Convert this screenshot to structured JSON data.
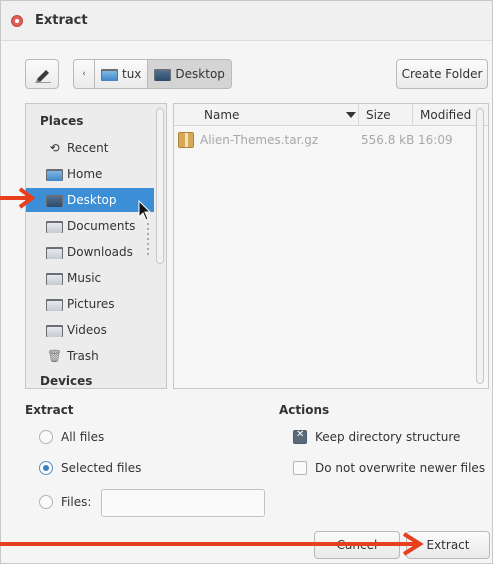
{
  "title": "Extract",
  "toolbar": {
    "create_folder_label": "Create Folder"
  },
  "pathbar": {
    "arrow_label": "‹",
    "crumbs": [
      {
        "label": "tux",
        "icon": "home-folder-icon"
      },
      {
        "label": "Desktop",
        "icon": "desktop-folder-icon"
      }
    ]
  },
  "places": {
    "header": "Places",
    "items": [
      {
        "label": "Recent",
        "icon": "recent-icon"
      },
      {
        "label": "Home",
        "icon": "home-folder-icon"
      },
      {
        "label": "Desktop",
        "icon": "desktop-folder-icon",
        "selected": true
      },
      {
        "label": "Documents",
        "icon": "documents-folder-icon"
      },
      {
        "label": "Downloads",
        "icon": "downloads-folder-icon"
      },
      {
        "label": "Music",
        "icon": "music-folder-icon"
      },
      {
        "label": "Pictures",
        "icon": "pictures-folder-icon"
      },
      {
        "label": "Videos",
        "icon": "videos-folder-icon"
      },
      {
        "label": "Trash",
        "icon": "trash-icon"
      }
    ],
    "devices_header": "Devices"
  },
  "filelist": {
    "columns": [
      "Name",
      "Size",
      "Modified"
    ],
    "rows": [
      {
        "name": "Alien-Themes.tar.gz",
        "size": "556.8 kB",
        "modified": "16:09"
      }
    ]
  },
  "extract": {
    "title": "Extract",
    "all_files": "All files",
    "selected_files": "Selected files",
    "files_label": "Files:",
    "files_value": ""
  },
  "actions": {
    "title": "Actions",
    "keep_structure": "Keep directory structure",
    "keep_structure_checked": true,
    "no_overwrite": "Do not overwrite newer files",
    "no_overwrite_checked": false
  },
  "buttons": {
    "cancel": "Cancel",
    "extract": "Extract"
  },
  "colors": {
    "selection": "#3c8ed6",
    "annotation_arrow": "#e8401c"
  }
}
